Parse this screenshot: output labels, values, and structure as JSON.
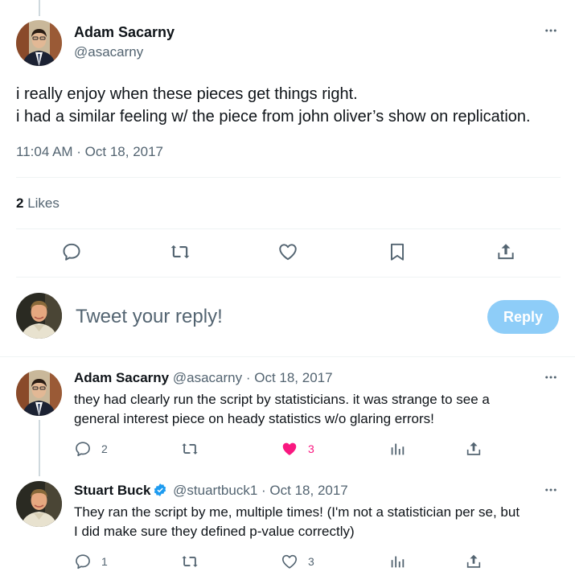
{
  "main_tweet": {
    "author_name": "Adam Sacarny",
    "author_handle": "@asacarny",
    "text_lines": [
      "i really enjoy when these pieces get things right.",
      "i had a similar feeling w/ the piece from john oliver’s show on replication."
    ],
    "timestamp": "11:04 AM · Oct 18, 2017",
    "likes_count": "2",
    "likes_label": "Likes"
  },
  "reply_box": {
    "placeholder": "Tweet your reply!",
    "button_label": "Reply"
  },
  "replies": [
    {
      "author_name": "Adam Sacarny",
      "author_handle": "@asacarny",
      "date": "· Oct 18, 2017",
      "text_lines": [
        "they had clearly run the script by statisticians. it was strange to see a",
        "general interest piece on heady statistics w/o glaring errors!"
      ],
      "reply_count": "2",
      "like_count": "3",
      "liked": true
    },
    {
      "author_name": "Stuart Buck",
      "author_handle": "@stuartbuck1",
      "date": "· Oct 18, 2017",
      "verified": true,
      "text_lines": [
        "They ran the script by me, multiple times! (I'm not a statistician per se, but",
        "I did make sure they defined p-value correctly)"
      ],
      "reply_count": "1",
      "like_count": "3",
      "liked": false
    }
  ],
  "colors": {
    "accent": "#1d9bf0",
    "reply_button_disabled": "#8ecdf8",
    "like_active": "#f91880",
    "secondary_text": "#536471"
  }
}
